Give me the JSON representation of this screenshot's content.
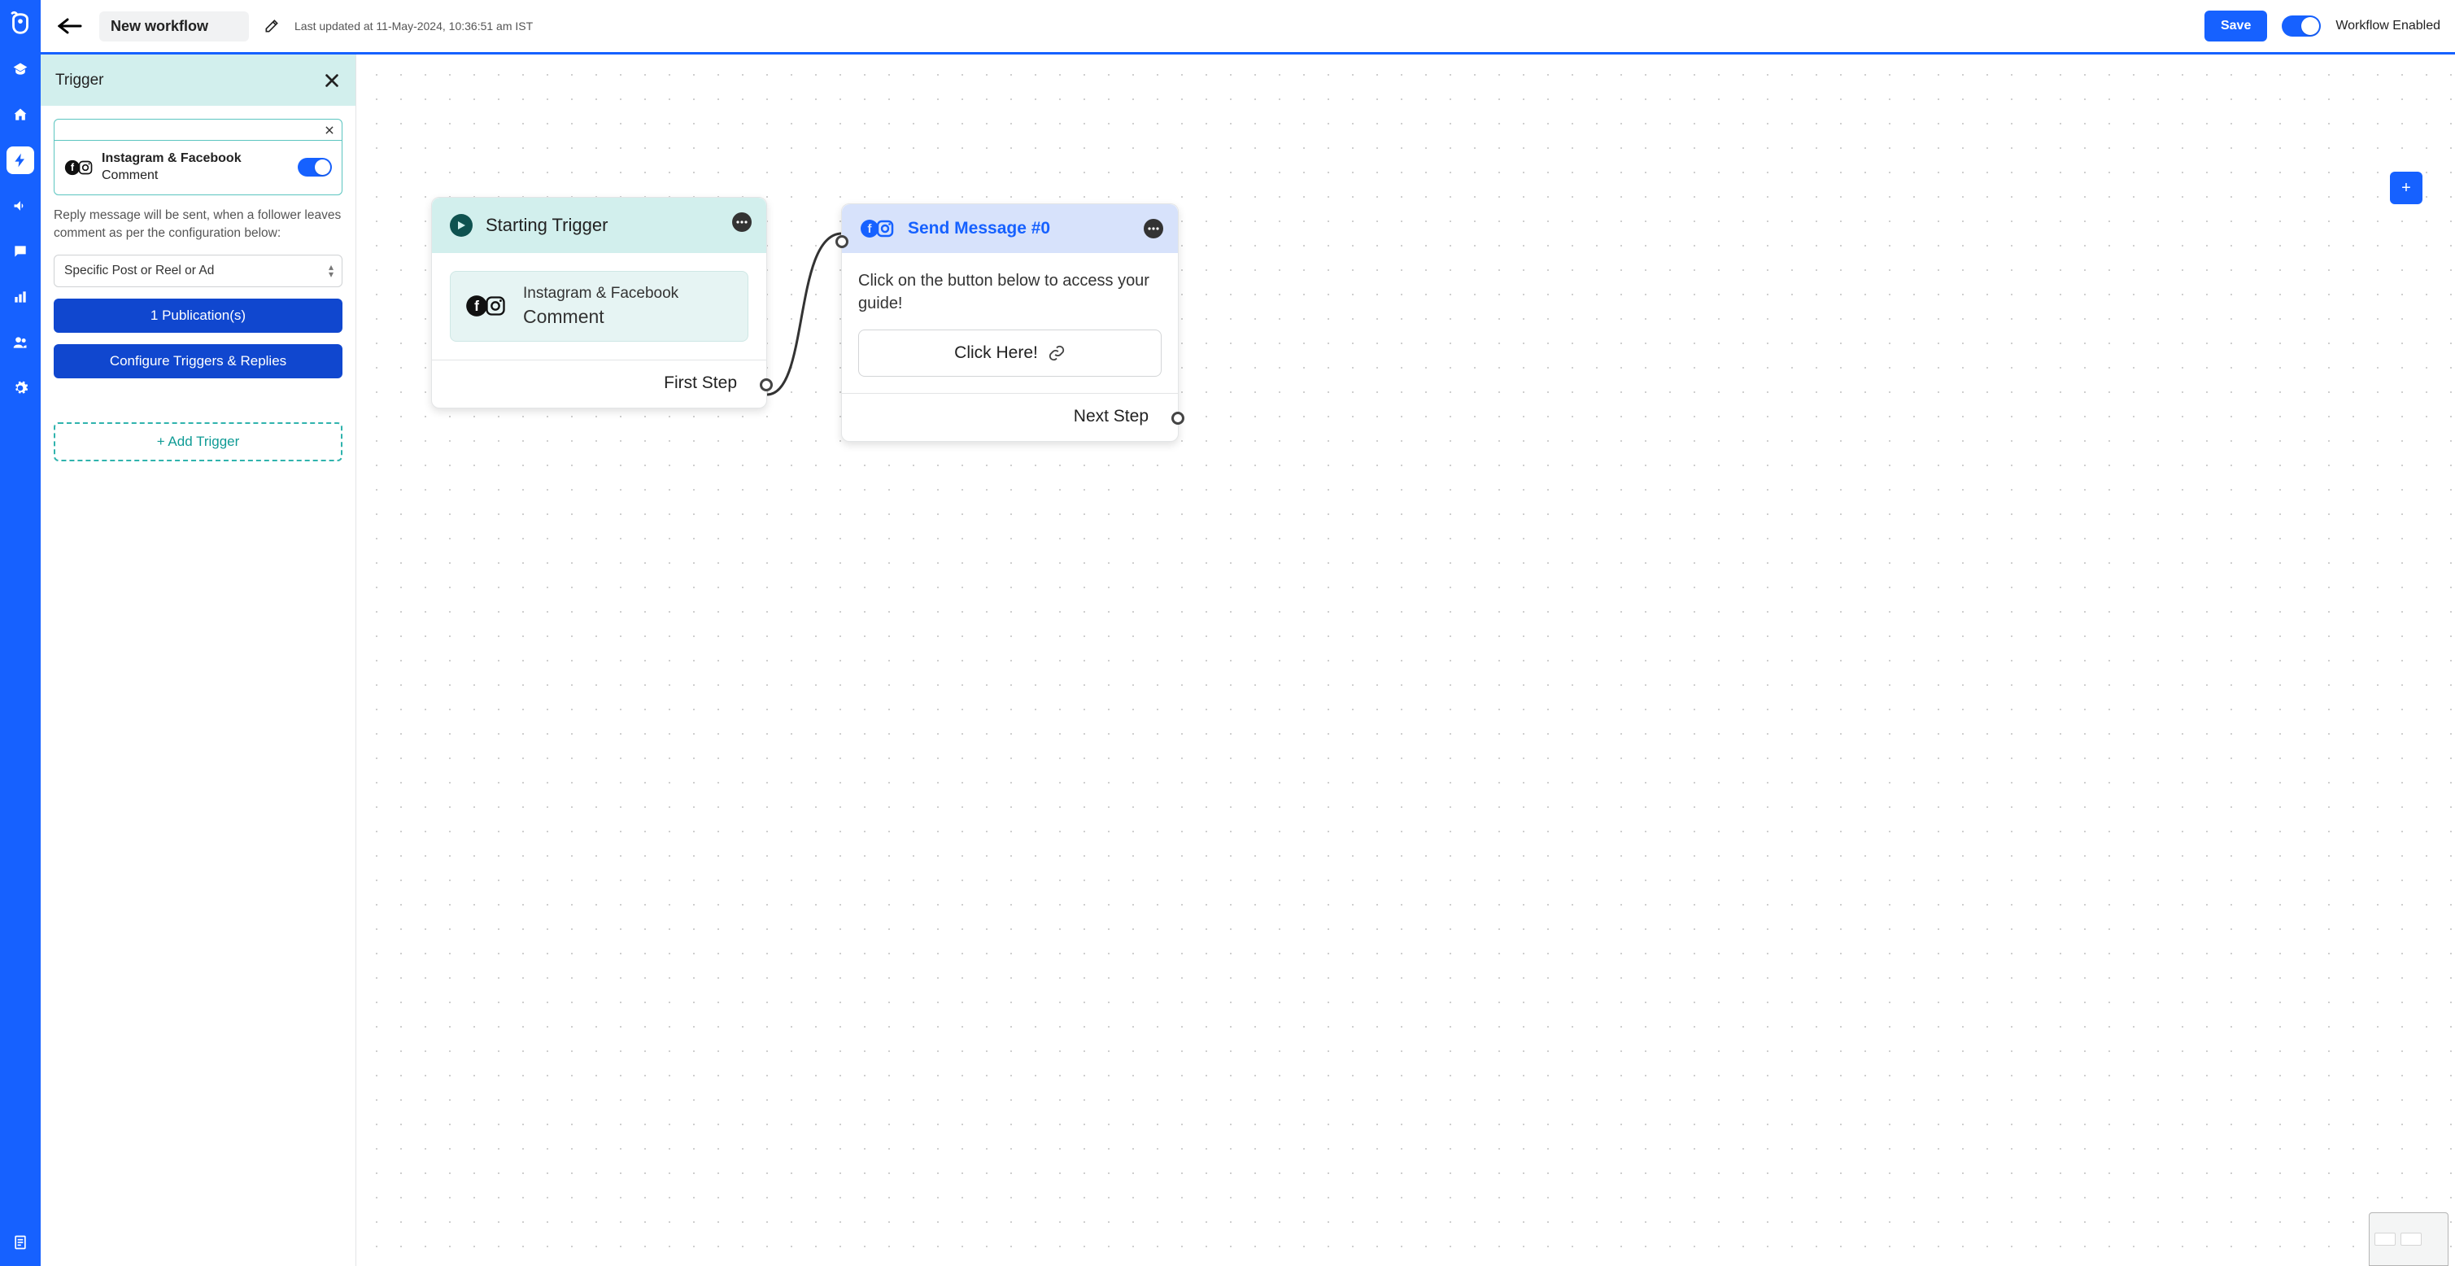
{
  "nav": {
    "items": [
      "graduation",
      "home",
      "bolt",
      "megaphone",
      "chat",
      "chart",
      "users",
      "gear"
    ],
    "doc": "document"
  },
  "header": {
    "title": "New workflow",
    "lastUpdated": "Last updated at 11-May-2024, 10:36:51 am IST",
    "saveLabel": "Save",
    "enabledLabel": "Workflow Enabled"
  },
  "panel": {
    "title": "Trigger",
    "triggerProvider": "Instagram & Facebook",
    "triggerEvent": "Comment",
    "helpText": "Reply message will be sent, when a follower leaves comment as per the configuration below:",
    "dropdownValue": "Specific Post or Reel or Ad",
    "pubsBtn": "1 Publication(s)",
    "configBtn": "Configure Triggers & Replies",
    "addTrigger": "+ Add Trigger"
  },
  "canvas": {
    "nodeA": {
      "title": "Starting Trigger",
      "provider": "Instagram & Facebook",
      "event": "Comment",
      "firstStep": "First Step"
    },
    "nodeB": {
      "title": "Send Message #0",
      "msg": "Click on the button below to access your guide!",
      "btn": "Click Here!",
      "nextStep": "Next Step"
    },
    "zoom": "+"
  }
}
